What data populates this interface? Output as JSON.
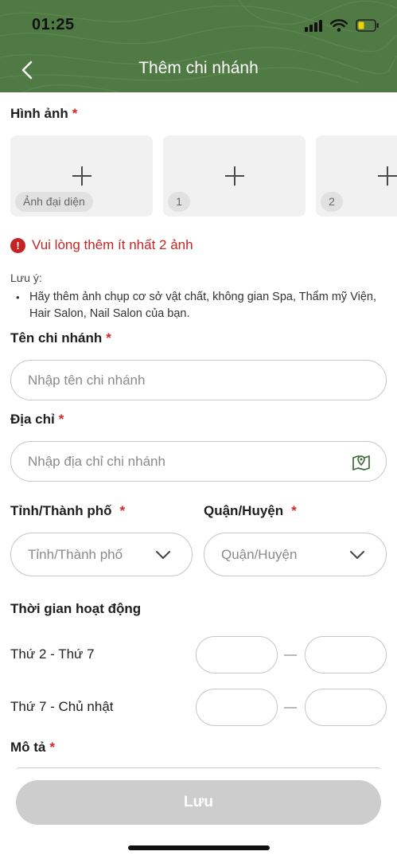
{
  "status_bar": {
    "time": "01:25"
  },
  "header": {
    "title": "Thêm chi nhánh",
    "bg_color": "#4f7a43"
  },
  "images": {
    "label": "Hình ảnh",
    "required_mark": "*",
    "slots": [
      {
        "tag": "Ảnh đại diện"
      },
      {
        "tag": "1"
      },
      {
        "tag": "2"
      }
    ],
    "error": "Vui lòng thêm ít nhất 2 ảnh"
  },
  "note": {
    "title": "Lưu ý:",
    "bullet": "Hãy thêm ảnh chụp cơ sở vật chất, không gian Spa, Thẩm mỹ Viện, Hair Salon, Nail Salon của bạn."
  },
  "branch_name": {
    "label": "Tên chi nhánh",
    "required_mark": "*",
    "placeholder": "Nhập tên chi nhánh"
  },
  "address": {
    "label": "Địa chỉ",
    "required_mark": "*",
    "placeholder": "Nhập địa chỉ chi nhánh"
  },
  "province": {
    "label": "Tỉnh/Thành phố",
    "required_mark": "*",
    "placeholder": "Tỉnh/Thành phố"
  },
  "district": {
    "label": "Quận/Huyện",
    "required_mark": "*",
    "placeholder": "Quận/Huyện"
  },
  "hours": {
    "title": "Thời gian hoạt động",
    "rows": [
      {
        "label": "Thứ 2 - Thứ 7"
      },
      {
        "label": "Thứ 7 - Chủ nhật"
      }
    ]
  },
  "description": {
    "label": "Mô tả",
    "required_mark": "*"
  },
  "save_button": {
    "label": "Lưu"
  },
  "colors": {
    "accent": "#4f7a43",
    "error": "#c62424",
    "disabled": "#cdcdcd"
  }
}
